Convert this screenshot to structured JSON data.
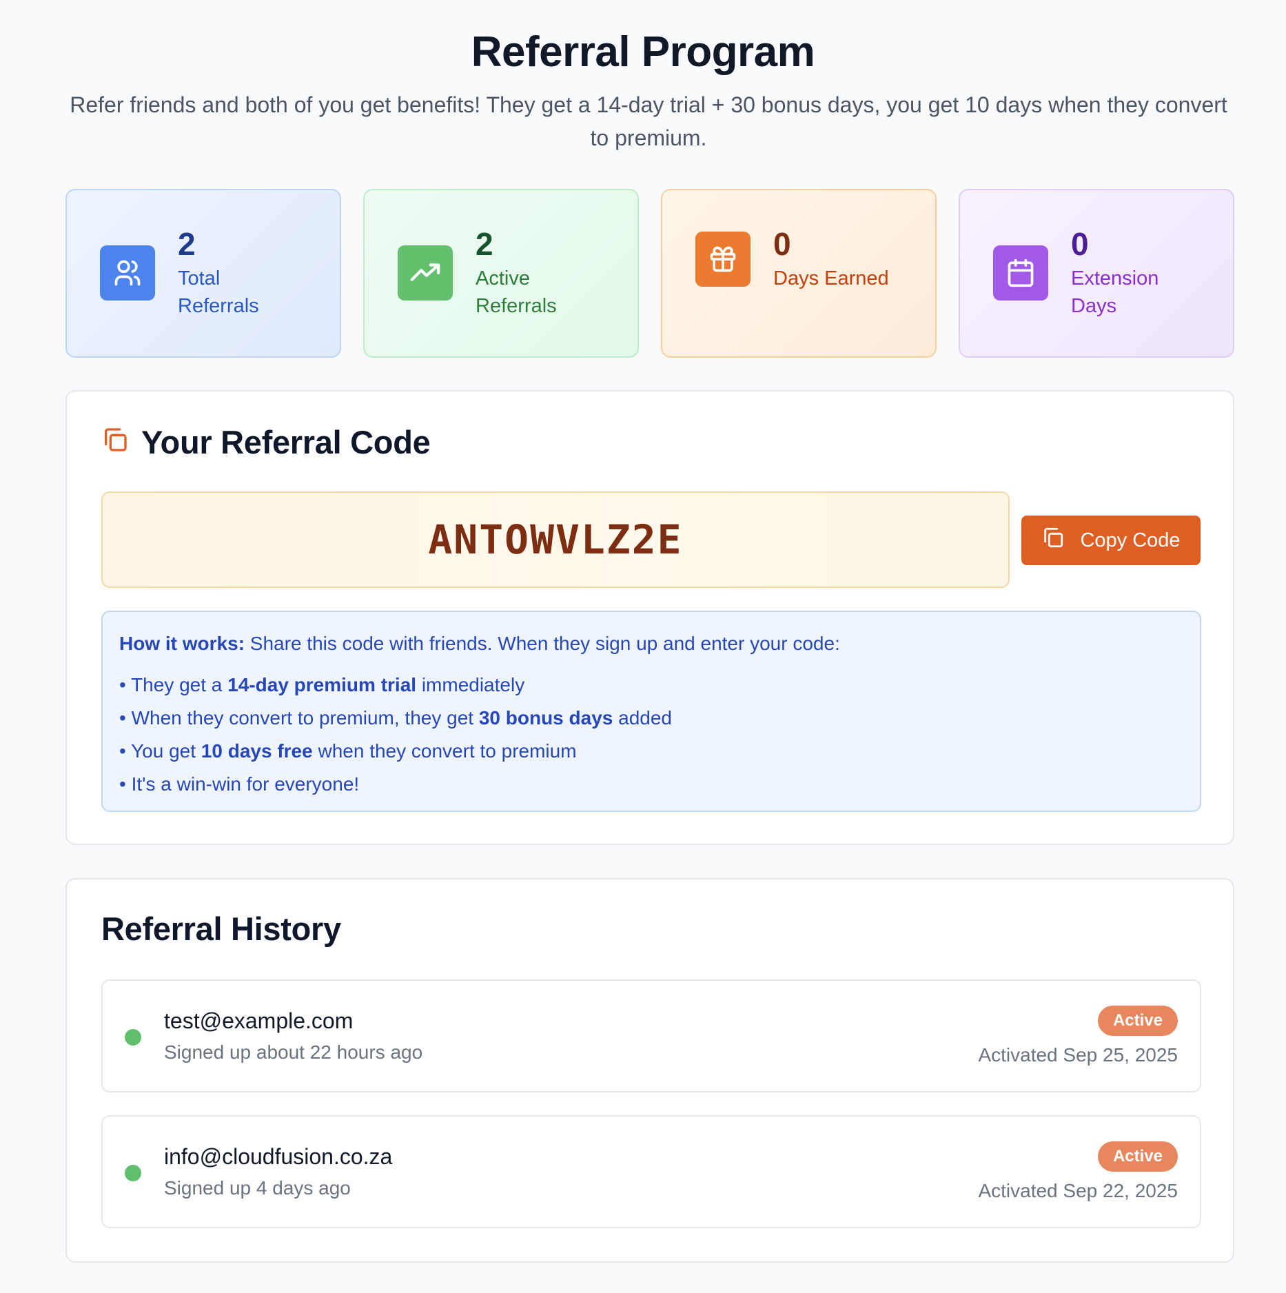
{
  "header": {
    "title": "Referral Program",
    "subtitle": "Refer friends and both of you get benefits! They get a 14-day trial + 30 bonus days, you get 10 days when they convert to premium."
  },
  "stats": [
    {
      "value": "2",
      "label": "Total Referrals",
      "icon": "users-icon",
      "color": "#4c84ee"
    },
    {
      "value": "2",
      "label": "Active Referrals",
      "icon": "trending-up-icon",
      "color": "#62c06d"
    },
    {
      "value": "0",
      "label": "Days Earned",
      "icon": "gift-icon",
      "color": "#ec7a2f"
    },
    {
      "value": "0",
      "label": "Extension Days",
      "icon": "calendar-icon",
      "color": "#a15ae8"
    }
  ],
  "referral_code": {
    "heading": "Your Referral Code",
    "heading_icon": "copy-icon",
    "code": "ANTOWVLZ2E",
    "copy_button_label": "Copy Code",
    "accent": "#dd5f24"
  },
  "how_it_works": {
    "label": "How it works:",
    "intro": " Share this code with friends. When they sign up and enter your code:",
    "items": [
      {
        "pre": "They get a ",
        "bold": "14-day premium trial",
        "post": " immediately"
      },
      {
        "pre": "When they convert to premium, they get ",
        "bold": "30 bonus days",
        "post": " added"
      },
      {
        "pre": "You get ",
        "bold": "10 days free",
        "post": " when they convert to premium"
      },
      {
        "pre": "It's a win-win for everyone!",
        "bold": "",
        "post": ""
      }
    ]
  },
  "history": {
    "heading": "Referral History",
    "rows": [
      {
        "email": "test@example.com",
        "signed_up": "Signed up about 22 hours ago",
        "status": "Active",
        "activated": "Activated Sep 25, 2025"
      },
      {
        "email": "info@cloudfusion.co.za",
        "signed_up": "Signed up 4 days ago",
        "status": "Active",
        "activated": "Activated Sep 22, 2025"
      }
    ]
  }
}
